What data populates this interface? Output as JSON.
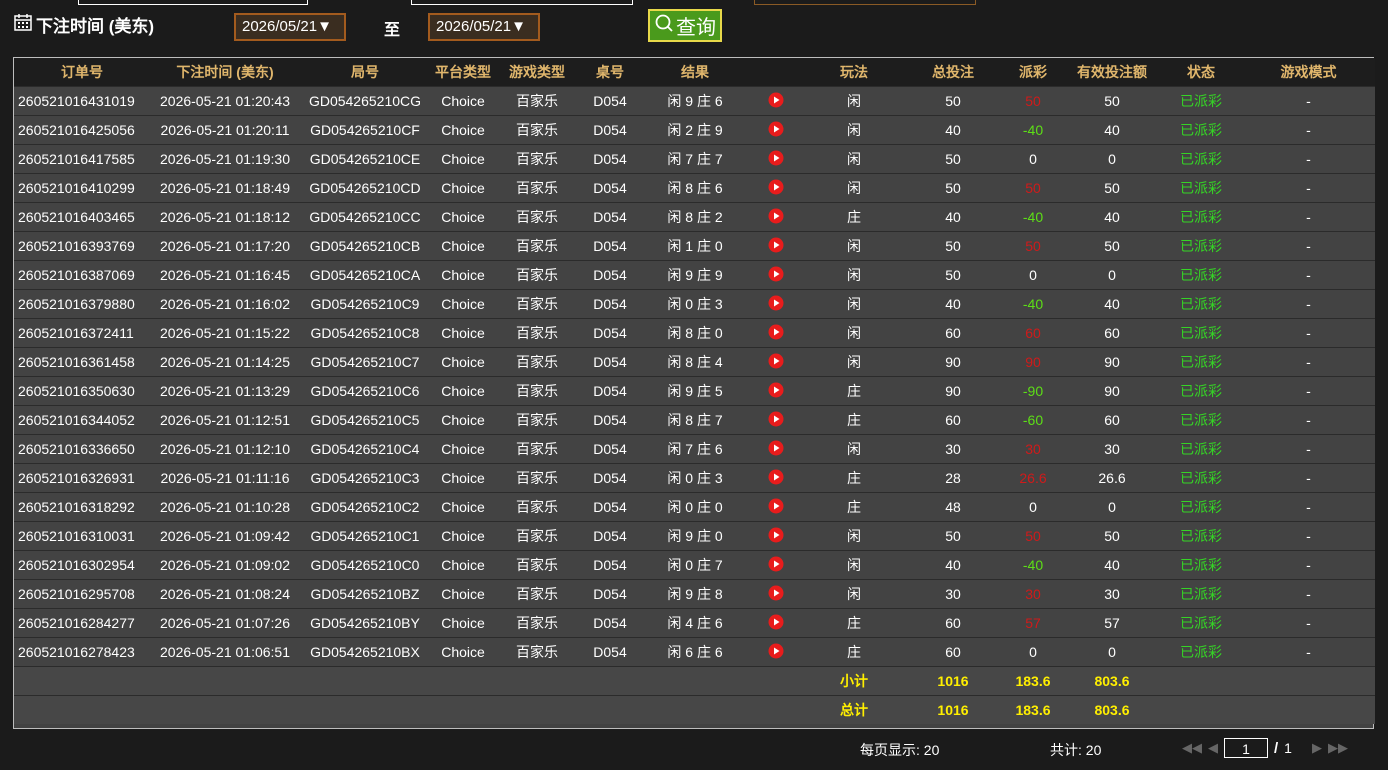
{
  "toolbar": {
    "time_label": "下注时间 (美东)",
    "start_date": "2026/05/21",
    "to_label": "至",
    "end_date": "2026/05/21",
    "query_label": "查询"
  },
  "table": {
    "headers": [
      "订单号",
      "下注时间 (美东)",
      "局号",
      "平台类型",
      "游戏类型",
      "桌号",
      "结果",
      "",
      "玩法",
      "总投注",
      "派彩",
      "有效投注额",
      "状态",
      "游戏模式"
    ],
    "rows": [
      {
        "order": "260521016431019",
        "time": "2026-05-21 01:20:43",
        "round": "GD054265210CG",
        "platform": "Choice",
        "game": "百家乐",
        "table": "D054",
        "result": "闲 9 庄 6",
        "play": "闲",
        "bet": "50",
        "payout": "50",
        "payout_type": "pos",
        "valid": "50",
        "status": "已派彩",
        "mode": "-"
      },
      {
        "order": "260521016425056",
        "time": "2026-05-21 01:20:11",
        "round": "GD054265210CF",
        "platform": "Choice",
        "game": "百家乐",
        "table": "D054",
        "result": "闲 2 庄 9",
        "play": "闲",
        "bet": "40",
        "payout": "-40",
        "payout_type": "neg",
        "valid": "40",
        "status": "已派彩",
        "mode": "-"
      },
      {
        "order": "260521016417585",
        "time": "2026-05-21 01:19:30",
        "round": "GD054265210CE",
        "platform": "Choice",
        "game": "百家乐",
        "table": "D054",
        "result": "闲 7 庄 7",
        "play": "闲",
        "bet": "50",
        "payout": "0",
        "payout_type": "zero",
        "valid": "0",
        "status": "已派彩",
        "mode": "-"
      },
      {
        "order": "260521016410299",
        "time": "2026-05-21 01:18:49",
        "round": "GD054265210CD",
        "platform": "Choice",
        "game": "百家乐",
        "table": "D054",
        "result": "闲 8 庄 6",
        "play": "闲",
        "bet": "50",
        "payout": "50",
        "payout_type": "pos",
        "valid": "50",
        "status": "已派彩",
        "mode": "-"
      },
      {
        "order": "260521016403465",
        "time": "2026-05-21 01:18:12",
        "round": "GD054265210CC",
        "platform": "Choice",
        "game": "百家乐",
        "table": "D054",
        "result": "闲 8 庄 2",
        "play": "庄",
        "bet": "40",
        "payout": "-40",
        "payout_type": "neg",
        "valid": "40",
        "status": "已派彩",
        "mode": "-"
      },
      {
        "order": "260521016393769",
        "time": "2026-05-21 01:17:20",
        "round": "GD054265210CB",
        "platform": "Choice",
        "game": "百家乐",
        "table": "D054",
        "result": "闲 1 庄 0",
        "play": "闲",
        "bet": "50",
        "payout": "50",
        "payout_type": "pos",
        "valid": "50",
        "status": "已派彩",
        "mode": "-"
      },
      {
        "order": "260521016387069",
        "time": "2026-05-21 01:16:45",
        "round": "GD054265210CA",
        "platform": "Choice",
        "game": "百家乐",
        "table": "D054",
        "result": "闲 9 庄 9",
        "play": "闲",
        "bet": "50",
        "payout": "0",
        "payout_type": "zero",
        "valid": "0",
        "status": "已派彩",
        "mode": "-"
      },
      {
        "order": "260521016379880",
        "time": "2026-05-21 01:16:02",
        "round": "GD054265210C9",
        "platform": "Choice",
        "game": "百家乐",
        "table": "D054",
        "result": "闲 0 庄 3",
        "play": "闲",
        "bet": "40",
        "payout": "-40",
        "payout_type": "neg",
        "valid": "40",
        "status": "已派彩",
        "mode": "-"
      },
      {
        "order": "260521016372411",
        "time": "2026-05-21 01:15:22",
        "round": "GD054265210C8",
        "platform": "Choice",
        "game": "百家乐",
        "table": "D054",
        "result": "闲 8 庄 0",
        "play": "闲",
        "bet": "60",
        "payout": "60",
        "payout_type": "pos",
        "valid": "60",
        "status": "已派彩",
        "mode": "-"
      },
      {
        "order": "260521016361458",
        "time": "2026-05-21 01:14:25",
        "round": "GD054265210C7",
        "platform": "Choice",
        "game": "百家乐",
        "table": "D054",
        "result": "闲 8 庄 4",
        "play": "闲",
        "bet": "90",
        "payout": "90",
        "payout_type": "pos",
        "valid": "90",
        "status": "已派彩",
        "mode": "-"
      },
      {
        "order": "260521016350630",
        "time": "2026-05-21 01:13:29",
        "round": "GD054265210C6",
        "platform": "Choice",
        "game": "百家乐",
        "table": "D054",
        "result": "闲 9 庄 5",
        "play": "庄",
        "bet": "90",
        "payout": "-90",
        "payout_type": "neg",
        "valid": "90",
        "status": "已派彩",
        "mode": "-"
      },
      {
        "order": "260521016344052",
        "time": "2026-05-21 01:12:51",
        "round": "GD054265210C5",
        "platform": "Choice",
        "game": "百家乐",
        "table": "D054",
        "result": "闲 8 庄 7",
        "play": "庄",
        "bet": "60",
        "payout": "-60",
        "payout_type": "neg",
        "valid": "60",
        "status": "已派彩",
        "mode": "-"
      },
      {
        "order": "260521016336650",
        "time": "2026-05-21 01:12:10",
        "round": "GD054265210C4",
        "platform": "Choice",
        "game": "百家乐",
        "table": "D054",
        "result": "闲 7 庄 6",
        "play": "闲",
        "bet": "30",
        "payout": "30",
        "payout_type": "pos",
        "valid": "30",
        "status": "已派彩",
        "mode": "-"
      },
      {
        "order": "260521016326931",
        "time": "2026-05-21 01:11:16",
        "round": "GD054265210C3",
        "platform": "Choice",
        "game": "百家乐",
        "table": "D054",
        "result": "闲 0 庄 3",
        "play": "庄",
        "bet": "28",
        "payout": "26.6",
        "payout_type": "pos",
        "valid": "26.6",
        "status": "已派彩",
        "mode": "-"
      },
      {
        "order": "260521016318292",
        "time": "2026-05-21 01:10:28",
        "round": "GD054265210C2",
        "platform": "Choice",
        "game": "百家乐",
        "table": "D054",
        "result": "闲 0 庄 0",
        "play": "庄",
        "bet": "48",
        "payout": "0",
        "payout_type": "zero",
        "valid": "0",
        "status": "已派彩",
        "mode": "-"
      },
      {
        "order": "260521016310031",
        "time": "2026-05-21 01:09:42",
        "round": "GD054265210C1",
        "platform": "Choice",
        "game": "百家乐",
        "table": "D054",
        "result": "闲 9 庄 0",
        "play": "闲",
        "bet": "50",
        "payout": "50",
        "payout_type": "pos",
        "valid": "50",
        "status": "已派彩",
        "mode": "-"
      },
      {
        "order": "260521016302954",
        "time": "2026-05-21 01:09:02",
        "round": "GD054265210C0",
        "platform": "Choice",
        "game": "百家乐",
        "table": "D054",
        "result": "闲 0 庄 7",
        "play": "闲",
        "bet": "40",
        "payout": "-40",
        "payout_type": "neg",
        "valid": "40",
        "status": "已派彩",
        "mode": "-"
      },
      {
        "order": "260521016295708",
        "time": "2026-05-21 01:08:24",
        "round": "GD054265210BZ",
        "platform": "Choice",
        "game": "百家乐",
        "table": "D054",
        "result": "闲 9 庄 8",
        "play": "闲",
        "bet": "30",
        "payout": "30",
        "payout_type": "pos",
        "valid": "30",
        "status": "已派彩",
        "mode": "-"
      },
      {
        "order": "260521016284277",
        "time": "2026-05-21 01:07:26",
        "round": "GD054265210BY",
        "platform": "Choice",
        "game": "百家乐",
        "table": "D054",
        "result": "闲 4 庄 6",
        "play": "庄",
        "bet": "60",
        "payout": "57",
        "payout_type": "pos",
        "valid": "57",
        "status": "已派彩",
        "mode": "-"
      },
      {
        "order": "260521016278423",
        "time": "2026-05-21 01:06:51",
        "round": "GD054265210BX",
        "platform": "Choice",
        "game": "百家乐",
        "table": "D054",
        "result": "闲 6 庄 6",
        "play": "庄",
        "bet": "60",
        "payout": "0",
        "payout_type": "zero",
        "valid": "0",
        "status": "已派彩",
        "mode": "-"
      }
    ],
    "subtotal": {
      "label": "小计",
      "bet": "1016",
      "payout": "183.6",
      "valid": "803.6"
    },
    "total": {
      "label": "总计",
      "bet": "1016",
      "payout": "183.6",
      "valid": "803.6"
    }
  },
  "footer": {
    "per_page": "每页显示: 20",
    "total_count": "共计: 20",
    "current_page": "1",
    "page_sep": "/",
    "total_pages": "1"
  },
  "colors": {
    "header_text": "#e0b66c",
    "row_bg": "#434343",
    "negative": "#5ddf16",
    "positive": "#d01a1a",
    "status": "#35d425",
    "sum_text": "#ffef00"
  }
}
